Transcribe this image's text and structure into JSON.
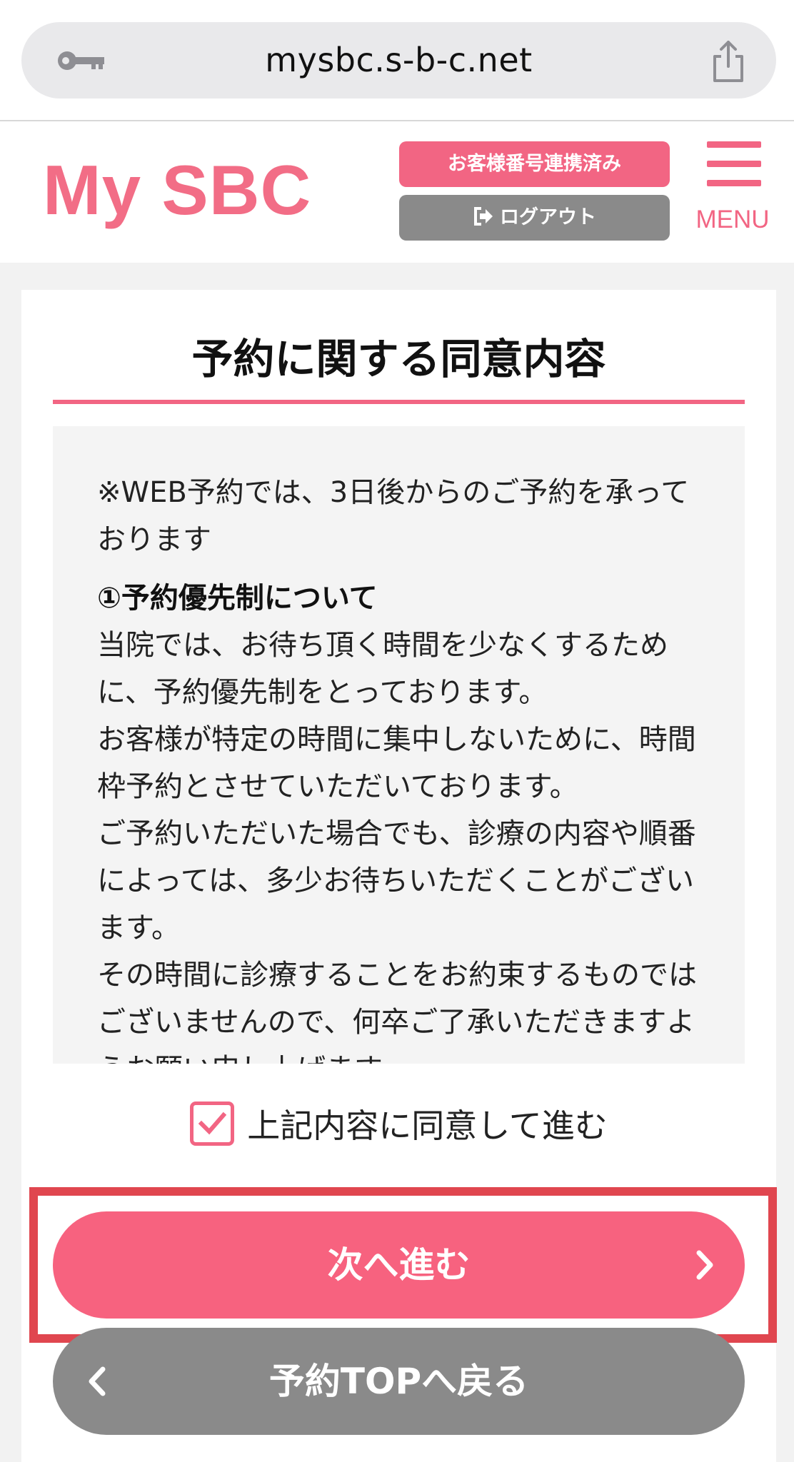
{
  "browser": {
    "url": "mysbc.s-b-c.net",
    "left_icon": "key-icon",
    "right_icon": "share-icon"
  },
  "header": {
    "logo": "My SBC",
    "linked_badge": "お客様番号連携済み",
    "logout_label": "ログアウト",
    "menu_label": "MENU"
  },
  "main": {
    "title": "予約に関する同意内容",
    "terms": {
      "intro": "※WEB予約では、3日後からのご予約を承っております",
      "section1_heading": "①予約優先制について",
      "section1_body": [
        "当院では、お待ち頂く時間を少なくするために、予約優先制をとっております。",
        "お客様が特定の時間に集中しないために、時間枠予約とさせていただいております。",
        "ご予約いただいた場合でも、診療の内容や順番によっては、多少お待ちいただくことがございます。",
        "その時間に診療することをお約束するものではございませんので、何卒ご了承いただきますようお願い申し上げます。"
      ]
    },
    "agree": {
      "checked": true,
      "label": "上記内容に同意して進む"
    },
    "next_button": "次へ進む",
    "back_button": "予約TOPへ戻る"
  },
  "colors": {
    "accent": "#f26583",
    "gray_button": "#8a8a8a",
    "highlight": "#e0464f"
  }
}
